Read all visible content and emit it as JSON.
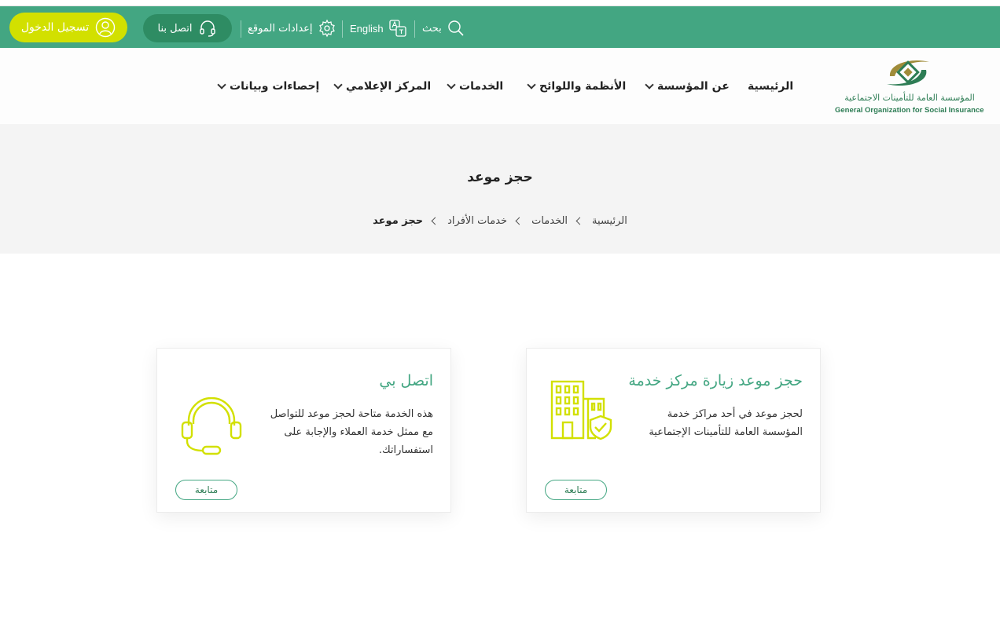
{
  "topbar": {
    "login_label": "تسجيل الدخول",
    "contact_label": "اتصل بنا",
    "settings_label": "إعدادات الموقع",
    "language_label": "English",
    "search_label": "بحث",
    "colors": {
      "bar": "#43a682",
      "login": "#d2e000",
      "contact": "#2e8c63"
    }
  },
  "logo": {
    "arabic_name": "المؤسسة العامة للتأمينات الاجتماعية",
    "english_name": "General Organization for Social Insurance"
  },
  "nav": {
    "items": [
      {
        "label": "الرئيسية",
        "has_dropdown": false
      },
      {
        "label": "عن المؤسسة",
        "has_dropdown": true
      },
      {
        "label": "الأنظمة واللوائح",
        "has_dropdown": true
      },
      {
        "label": "الخدمات",
        "has_dropdown": true
      },
      {
        "label": "المركز الإعلامي",
        "has_dropdown": true
      },
      {
        "label": "إحصاءات وبيانات",
        "has_dropdown": true
      }
    ]
  },
  "page": {
    "title": "حجز موعد",
    "breadcrumb": [
      "الرئيسية",
      "الخدمات",
      "خدمات الأفراد",
      "حجز موعد"
    ]
  },
  "cards": [
    {
      "title": "حجز موعد زيارة مركز خدمة",
      "description": "لحجز موعد في أحد مراكز خدمة المؤسسة العامة للتأمينات الإجتماعية",
      "icon": "building-shield-icon",
      "button_label": "متابعة"
    },
    {
      "title": "اتصل بي",
      "description": "هذه الخدمة متاحة لحجز موعد للتواصل مع ممثل خدمة العملاء والإجابة على استفساراتك.",
      "icon": "headset-icon",
      "button_label": "متابعة"
    }
  ],
  "accent_color": "#43a682",
  "icon_color": "#d2e000"
}
